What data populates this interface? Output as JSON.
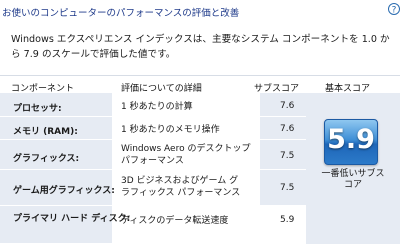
{
  "page": {
    "title": "お使いのコンピューターのパフォーマンスの評価と改善",
    "description": "Windows エクスペリエンス インデックスは、主要なシステム コンポーネントを 1.0 から 7.9 のスケールで評価した値です。"
  },
  "table": {
    "headers": {
      "component": "コンポーネント",
      "detail": "評価についての詳細",
      "subscore": "サブスコア",
      "basescore": "基本スコア"
    },
    "rows": [
      {
        "component": "プロセッサ:",
        "detail": [
          "1 秒あたりの計算"
        ],
        "subscore": "7.6"
      },
      {
        "component": "メモリ (RAM):",
        "detail": [
          "1 秒あたりのメモリ操作"
        ],
        "subscore": "7.6"
      },
      {
        "component": "グラフィックス:",
        "detail": [
          "Windows Aero のデスクトップ",
          "パフォーマンス"
        ],
        "subscore": "7.5"
      },
      {
        "component": "ゲーム用グラフィックス:",
        "detail": [
          "3D ビジネスおよびゲーム グ",
          "ラフィックス パフォーマンス"
        ],
        "subscore": "7.5"
      },
      {
        "component": "プライマリ ハード ディスク:",
        "detail": [
          "ディスクのデータ転送速度"
        ],
        "subscore": "5.9"
      }
    ]
  },
  "base_score": {
    "value": "5.9",
    "caption_lines": [
      "一番低いサブス",
      "コア"
    ]
  },
  "colors": {
    "title": "#1e3a8a",
    "label_background": "#e6ebf3",
    "badge": "#2c7ac9"
  },
  "icons": {
    "help": "help-question-icon"
  }
}
